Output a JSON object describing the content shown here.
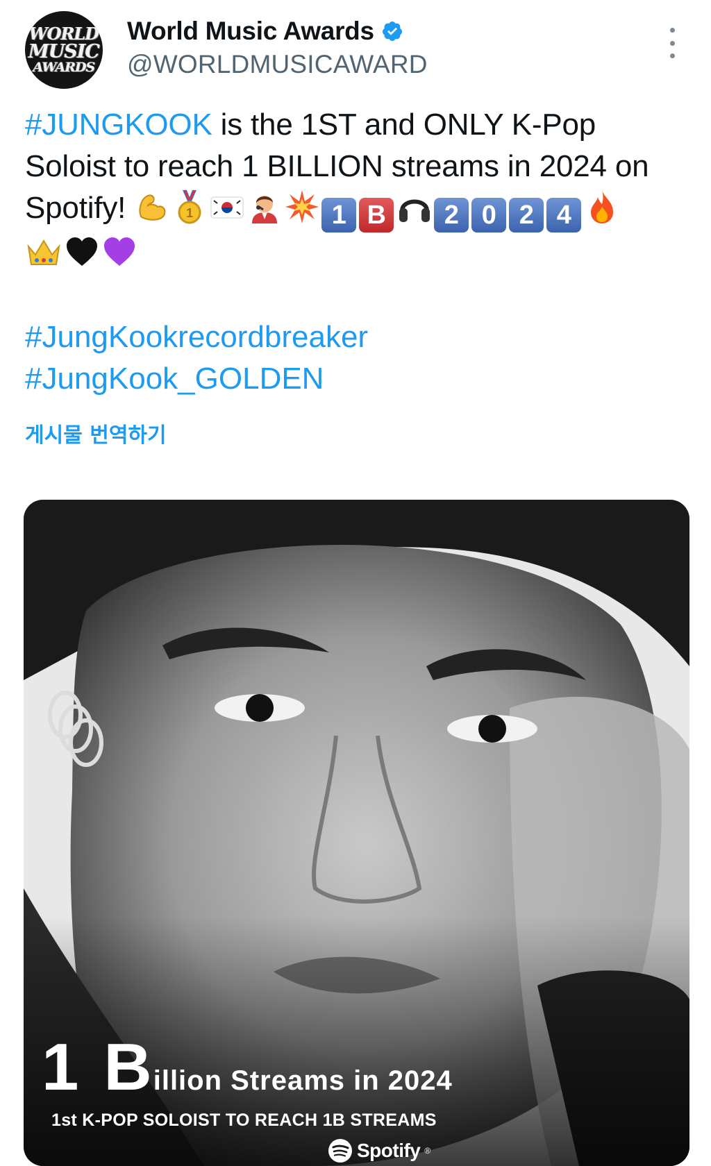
{
  "account": {
    "display_name": "World Music Awards",
    "handle": "@WORLDMUSICAWARD",
    "avatar_lines": [
      "WORLD",
      "MUSIC",
      "AWARDS"
    ],
    "verified_color": "#1d9bf0"
  },
  "tweet": {
    "hashtag_main": "#JUNGKOOK",
    "text_1": " is the 1ST and ONLY K-Pop Soloist to reach 1 BILLION streams in 2024 on Spotify!",
    "emojis_after_text": [
      "flexed-biceps",
      "1st-place-medal",
      "south-korea-flag",
      "singer",
      "collision"
    ],
    "keycap_1": "1",
    "keycap_b": "B",
    "headphone_emoji": "headphone",
    "keycaps_year": [
      "2",
      "0",
      "2",
      "4"
    ],
    "emojis_tail": [
      "fire"
    ],
    "emojis_line2": [
      "crown",
      "black-heart",
      "purple-heart"
    ],
    "hashtags": [
      "#JungKookrecordbreaker",
      "#JungKook_GOLDEN"
    ],
    "translate_label": "게시물 번역하기"
  },
  "media": {
    "big_one": "1",
    "big_b": "B",
    "big_rest": "illion Streams in 2024",
    "sub_line": "1st K-POP SOLOIST TO REACH 1B STREAMS",
    "brand": "Spotify",
    "brand_mark": "®"
  },
  "colors": {
    "link": "#1d9bf0",
    "text": "#0f1419",
    "muted": "#536471"
  }
}
